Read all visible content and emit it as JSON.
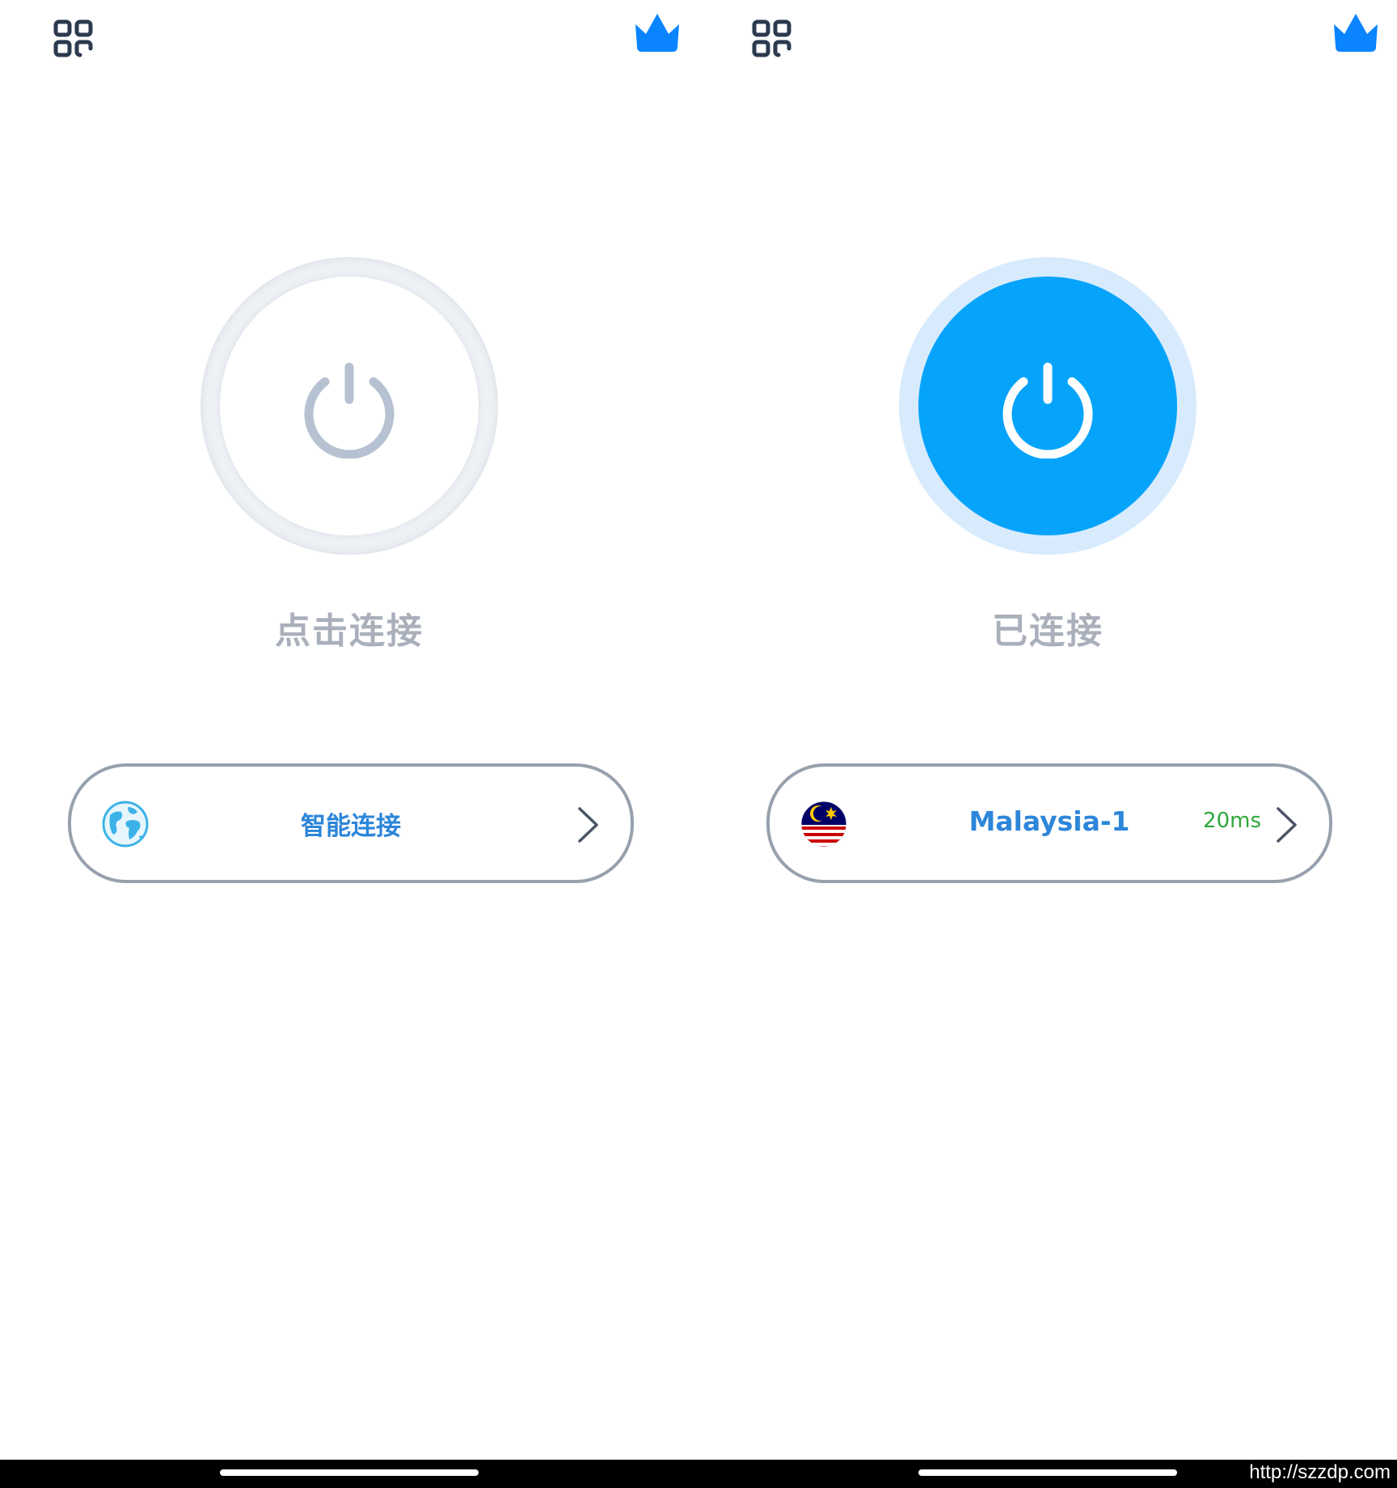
{
  "colors": {
    "accent_blue": "#06a3fb",
    "crown_blue": "#0a84ff",
    "label_blue": "#2d86d9",
    "status_gray": "#a9b0bb",
    "latency_green": "#2fa83a",
    "pill_border": "#97a1ad"
  },
  "left_screen": {
    "menu_icon": "grid-menu-icon",
    "premium_icon": "crown-icon",
    "power_button": {
      "state": "disconnected",
      "icon": "power-icon"
    },
    "status_text": "点击连接",
    "server": {
      "icon": "globe-icon",
      "label": "智能连接",
      "chevron": "chevron-right-icon"
    }
  },
  "right_screen": {
    "menu_icon": "grid-menu-icon",
    "premium_icon": "crown-icon",
    "power_button": {
      "state": "connected",
      "icon": "power-icon"
    },
    "status_text": "已连接",
    "server": {
      "icon": "malaysia-flag-icon",
      "label": "Malaysia-1",
      "latency": "20ms",
      "chevron": "chevron-right-icon"
    }
  },
  "watermark": "http://szzdp.com"
}
